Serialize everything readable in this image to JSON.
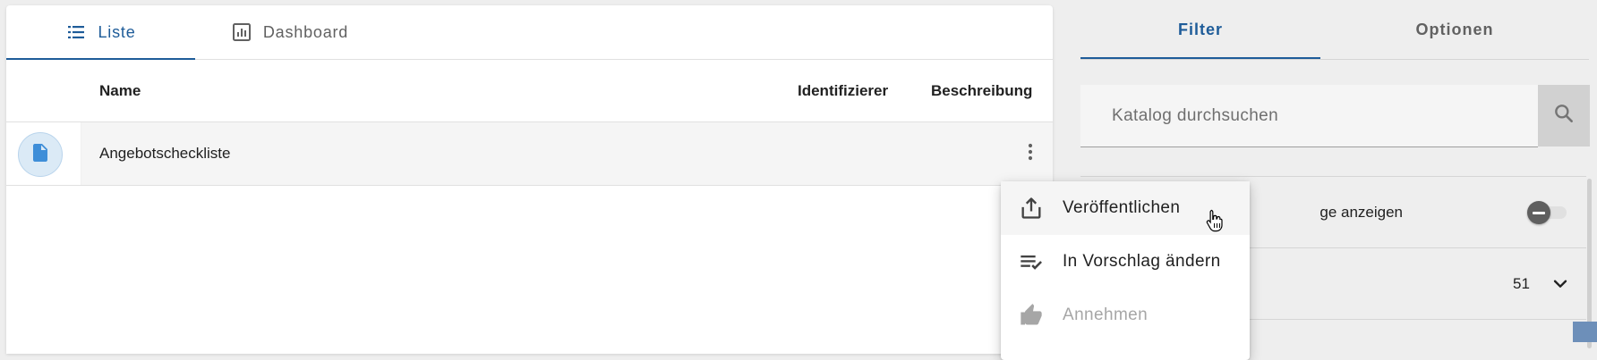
{
  "list_view": {
    "tabs": [
      {
        "label": "Liste",
        "icon": "list-icon",
        "active": true
      },
      {
        "label": "Dashboard",
        "icon": "dashboard-icon",
        "active": false
      }
    ],
    "columns": {
      "name": "Name",
      "identifier": "Identifizierer",
      "description": "Beschreibung"
    },
    "rows": [
      {
        "icon": "document-icon",
        "name": "Angebotscheckliste",
        "identifier": "",
        "description": ""
      }
    ]
  },
  "context_menu": {
    "items": [
      {
        "label": "Veröffentlichen",
        "icon": "publish-icon",
        "enabled": true
      },
      {
        "label": "In Vorschlag ändern",
        "icon": "playlist-check-icon",
        "enabled": true
      },
      {
        "label": "Annehmen",
        "icon": "thumb-up-icon",
        "enabled": false
      }
    ]
  },
  "side_panel": {
    "tabs": [
      {
        "label": "Filter",
        "active": true
      },
      {
        "label": "Optionen",
        "active": false
      }
    ],
    "search": {
      "placeholder": "Katalog durchsuchen",
      "value": ""
    },
    "filters": {
      "toggle_label_visible": "ge anzeigen",
      "toggle_on": false,
      "count": "51"
    }
  },
  "colors": {
    "accent": "#1e5c99",
    "background": "#eeeeee",
    "selected_row": "#f5f5f5",
    "disabled_text": "#a6a6a6"
  }
}
